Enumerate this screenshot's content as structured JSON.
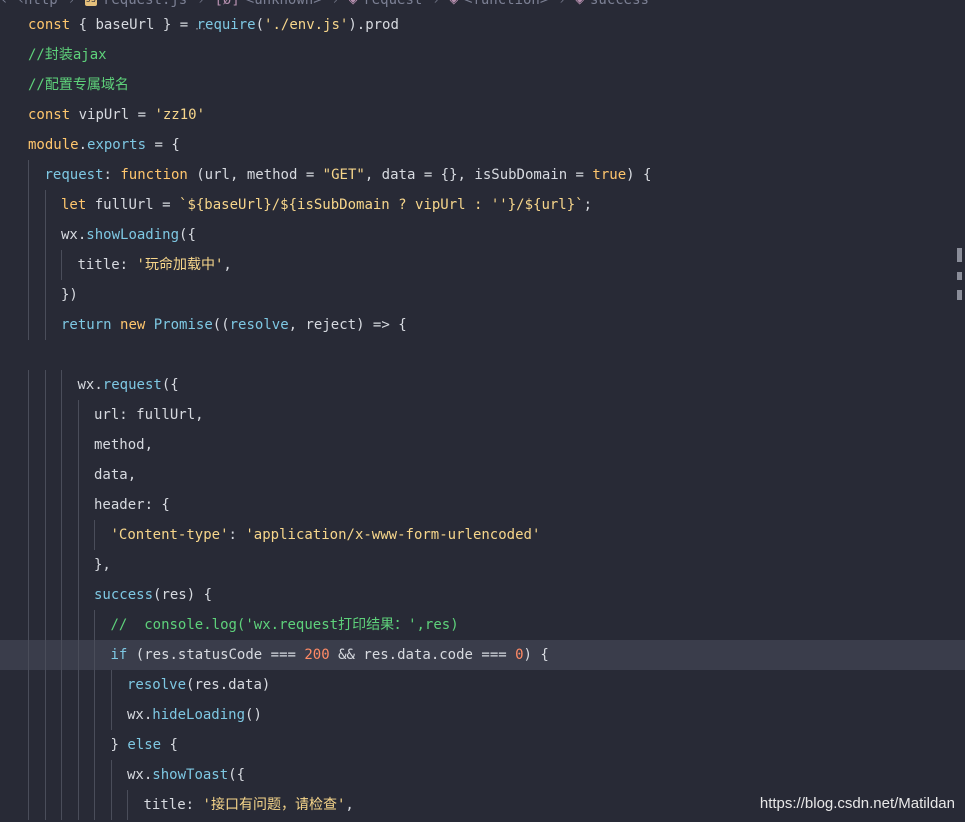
{
  "breadcrumb": {
    "items": [
      "http",
      "request.js",
      "<unknown>",
      "request",
      "<function>",
      "success"
    ]
  },
  "code_lines": [
    "const { baseUrl } = require('./env.js').prod",
    "//封装ajax",
    "//配置专属域名",
    "const vipUrl = 'zz10'",
    "module.exports = {",
    "  request: function (url, method = \"GET\", data = {}, isSubDomain = true) {",
    "    let fullUrl = `${baseUrl}/${isSubDomain ? vipUrl : ''}/${url}`;",
    "    wx.showLoading({",
    "      title: '玩命加载中',",
    "    })",
    "    return new Promise((resolve, reject) => {",
    "",
    "      wx.request({",
    "        url: fullUrl,",
    "        method,",
    "        data,",
    "        header: {",
    "          'Content-type': 'application/x-www-form-urlencoded'",
    "        },",
    "        success(res) {",
    "          //  console.log('wx.request打印结果：',res)",
    "          if (res.statusCode === 200 && res.data.code === 0) {",
    "            resolve(res.data)",
    "            wx.hideLoading()",
    "          } else {",
    "            wx.showToast({",
    "              title: '接口有问题，请检查',"
  ],
  "watermark": "https://blog.csdn.net/Matildan"
}
